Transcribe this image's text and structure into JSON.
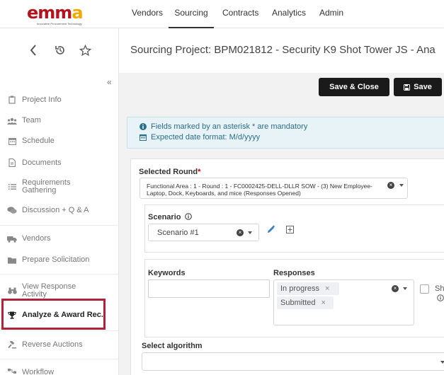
{
  "topnav": {
    "logo_text": "emma",
    "logo_tagline": "Innovative Procurement Technology",
    "items": [
      {
        "label": "Vendors",
        "active": false
      },
      {
        "label": "Sourcing",
        "active": true
      },
      {
        "label": "Contracts",
        "active": false
      },
      {
        "label": "Analytics",
        "active": false
      },
      {
        "label": "Admin",
        "active": false
      }
    ]
  },
  "header": {
    "title": "Sourcing Project: BPM021812 - Security K9 Shot Tower JS - Ana"
  },
  "sidebar": {
    "collapse_label": "«",
    "items": [
      {
        "label": "Project Info",
        "icon": "clipboard-icon"
      },
      {
        "label": "Team",
        "icon": "users-icon"
      },
      {
        "label": "Schedule",
        "icon": "calendar-icon"
      },
      {
        "label": "Documents",
        "icon": "document-icon"
      },
      {
        "label": "Requirements Gathering",
        "icon": "list-icon"
      },
      {
        "label": "Discussion + Q & A",
        "icon": "comments-icon"
      },
      {
        "label": "Vendors",
        "icon": "truck-icon"
      },
      {
        "label": "Prepare Solicitation",
        "icon": "folder-icon"
      },
      {
        "label": "View Response Activity",
        "icon": "binoculars-icon"
      },
      {
        "label": "Analyze & Award Rec.",
        "icon": "trophy-icon",
        "active": true
      },
      {
        "label": "Reverse Auctions",
        "icon": "gavel-icon"
      },
      {
        "label": "Workflow",
        "icon": "workflow-icon"
      }
    ]
  },
  "toolbar": {
    "save_close_label": "Save & Close",
    "save_label": "Save"
  },
  "info": {
    "mandatory_text": "Fields marked by an asterisk * are mandatory",
    "date_format_text": "Expected date format: M/d/yyyy"
  },
  "form": {
    "selected_round_label": "Selected Round",
    "required_mark": "*",
    "selected_round_value": "Functional Area : 1 - Round : 1 - FC0002425-DELL-DLLR SOW - (3) New Employee- Laptop, Dock, Keyboards, and mice (Responses Opened)",
    "scenario_label": "Scenario",
    "scenario_value": "Scenario #1",
    "keywords_label": "Keywords",
    "keywords_value": "",
    "responses_label": "Responses",
    "responses_tags": [
      "In progress",
      "Submitted"
    ],
    "checkbox_label_partial": "Sh",
    "select_algorithm_label": "Select algorithm",
    "select_algorithm_value": ""
  },
  "colors": {
    "highlight": "#b0243a",
    "brand_red": "#b5121b",
    "brand_yellow": "#f2a900",
    "info_text": "#2b6f8a",
    "button_dark": "#1a1a1a"
  }
}
